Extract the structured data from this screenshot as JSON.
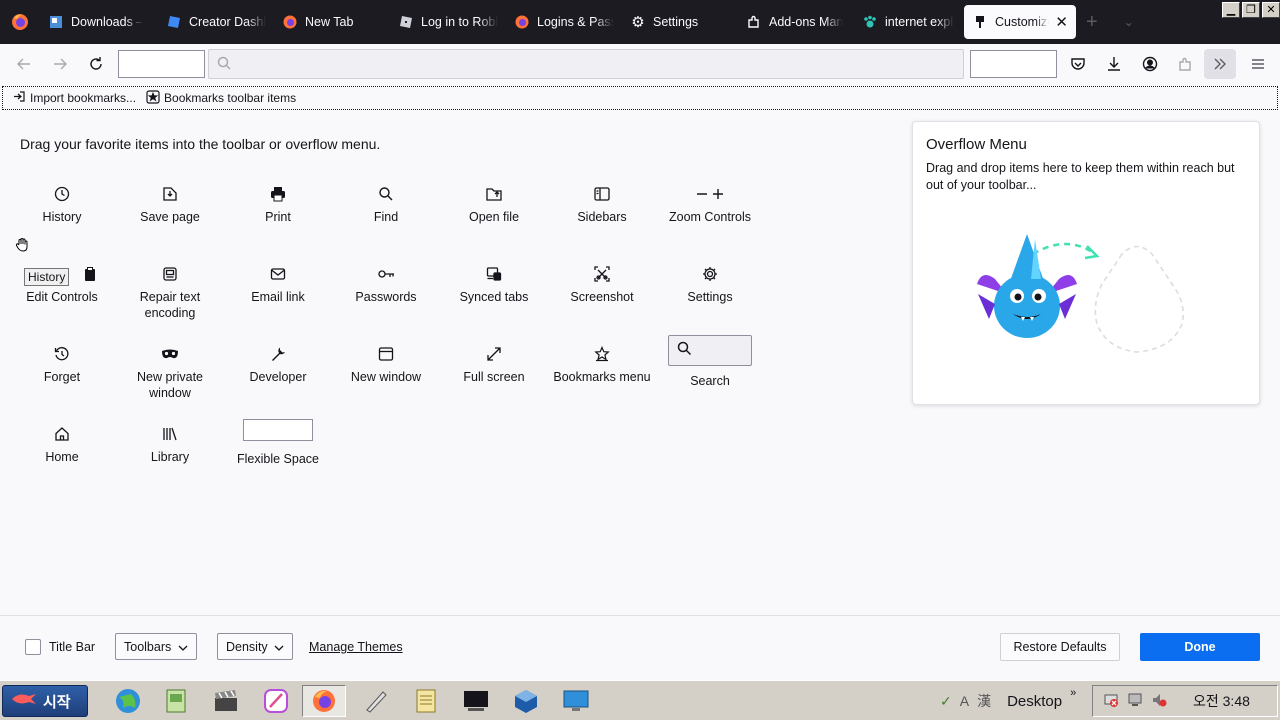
{
  "tabs": [
    {
      "label": "Downloads – ",
      "icon": "image-favicon-icon"
    },
    {
      "label": "Creator Dashb",
      "icon": "roblox-studio-icon"
    },
    {
      "label": "New Tab",
      "icon": "firefox-icon"
    },
    {
      "label": "Log in to Robl",
      "icon": "roblox-icon"
    },
    {
      "label": "Logins & Pass",
      "icon": "firefox-icon"
    },
    {
      "label": "Settings",
      "icon": "gear-icon"
    },
    {
      "label": "Add-ons Man",
      "icon": "puzzle-icon"
    },
    {
      "label": "internet explo",
      "icon": "paw-icon"
    },
    {
      "label": "Customize",
      "icon": "brush-icon",
      "active": true
    }
  ],
  "bookmarks_toolbar": {
    "import": "Import bookmarks...",
    "items": "Bookmarks toolbar items"
  },
  "palette": {
    "title": "Drag your favorite items into the toolbar or overflow menu.",
    "items": [
      {
        "label": "History",
        "icon": "clock-icon"
      },
      {
        "label": "Save page",
        "icon": "save-page-icon"
      },
      {
        "label": "Print",
        "icon": "printer-icon"
      },
      {
        "label": "Find",
        "icon": "magnifier-icon"
      },
      {
        "label": "Open file",
        "icon": "folder-icon"
      },
      {
        "label": "Sidebars",
        "icon": "sidebar-icon"
      },
      {
        "label": "Zoom Controls",
        "icon": "zoom-icon"
      },
      {
        "label": "Edit Controls",
        "icon": "clipboard-icon"
      },
      {
        "label": "Repair text encoding",
        "icon": "encoding-icon"
      },
      {
        "label": "Email link",
        "icon": "envelope-icon"
      },
      {
        "label": "Passwords",
        "icon": "key-icon"
      },
      {
        "label": "Synced tabs",
        "icon": "synced-tabs-icon"
      },
      {
        "label": "Screenshot",
        "icon": "screenshot-icon"
      },
      {
        "label": "Settings",
        "icon": "gear-icon"
      },
      {
        "label": "Forget",
        "icon": "forget-icon"
      },
      {
        "label": "New private window",
        "icon": "mask-icon"
      },
      {
        "label": "Developer",
        "icon": "wrench-icon"
      },
      {
        "label": "New window",
        "icon": "window-icon"
      },
      {
        "label": "Full screen",
        "icon": "expand-icon"
      },
      {
        "label": "Bookmarks menu",
        "icon": "star-icon"
      },
      {
        "label": "Search",
        "icon": "search-icon"
      },
      {
        "label": "Home",
        "icon": "home-icon"
      },
      {
        "label": "Library",
        "icon": "library-icon"
      },
      {
        "label": "Flexible Space",
        "icon": ""
      }
    ]
  },
  "tooltip": "History",
  "overflow": {
    "title": "Overflow Menu",
    "desc": "Drag and drop items here to keep them within reach but out of your toolbar..."
  },
  "footer": {
    "title_bar": "Title Bar",
    "toolbars": "Toolbars",
    "density": "Density",
    "manage_themes": "Manage Themes",
    "restore": "Restore Defaults",
    "done": "Done"
  },
  "taskbar": {
    "start": "시작",
    "desktop": "Desktop",
    "clock": "오전 3:48",
    "ime": [
      "A",
      "漢"
    ]
  },
  "colors": {
    "accent": "#0b6df0",
    "tabstrip": "#1c1b22"
  }
}
